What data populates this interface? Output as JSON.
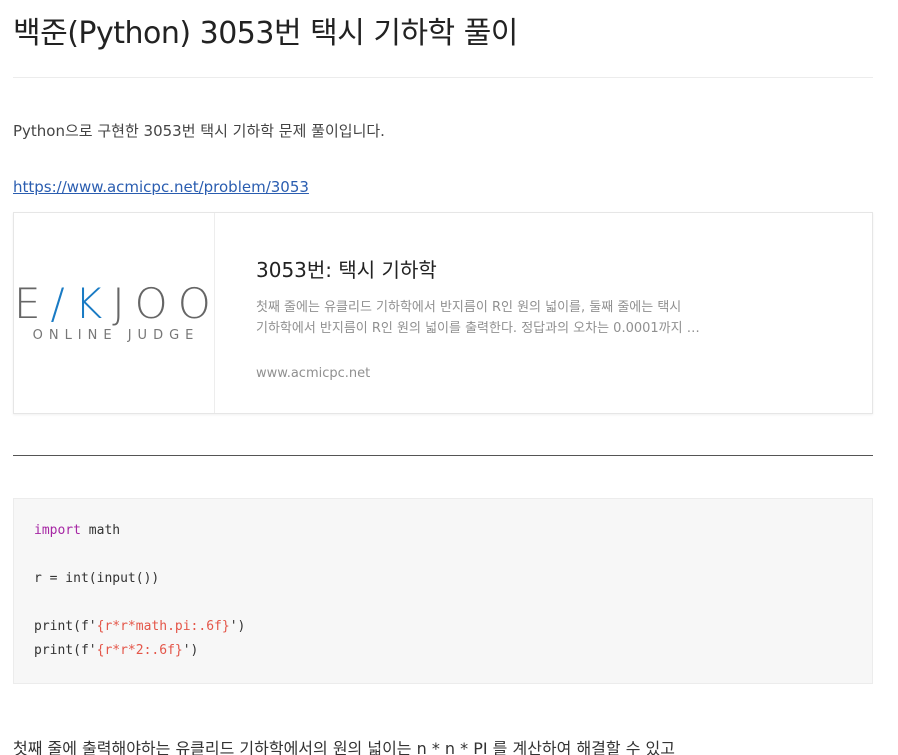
{
  "post": {
    "title": "백준(Python) 3053번 택시 기하학 풀이",
    "intro": "Python으로 구현한 3053번 택시 기하학 문제 풀이입니다.",
    "link_text": "https://www.acmicpc.net/problem/3053"
  },
  "link_card": {
    "logo_main_pre": "E",
    "logo_main_k": "/K",
    "logo_main_post": "JOO",
    "logo_sub": "ONLINE JUDGE",
    "title": "3053번: 택시 기하학",
    "description_line1": "첫째 줄에는 유클리드 기하학에서 반지름이 R인 원의 넓이를, 둘째 줄에는 택시",
    "description_line2": "기하학에서 반지름이 R인 원의 넓이를 출력한다. 정답과의 오차는 0.0001까지 …",
    "host": "www.acmicpc.net"
  },
  "code": {
    "line1_kw": "import",
    "line1_rest": " math",
    "line2": "r = int(input())",
    "line3_pre": "print(f'",
    "line3_sub": "{r*r*math.pi:.6f}",
    "line3_post": "')",
    "line4_pre": "print(f'",
    "line4_sub": "{r*r*2:.6f}",
    "line4_post": "')"
  },
  "conclusion": "첫째 줄에 출력해야하는 유클리드 기하학에서의 원의 넓이는 n * n * PI 를 계산하여 해결할 수 있고",
  "colors": {
    "link": "#2a5db0",
    "logo_accent": "#1a7bc4",
    "code_background": "#f7f7f7",
    "keyword": "#a626a4",
    "string": "#50a14f"
  }
}
